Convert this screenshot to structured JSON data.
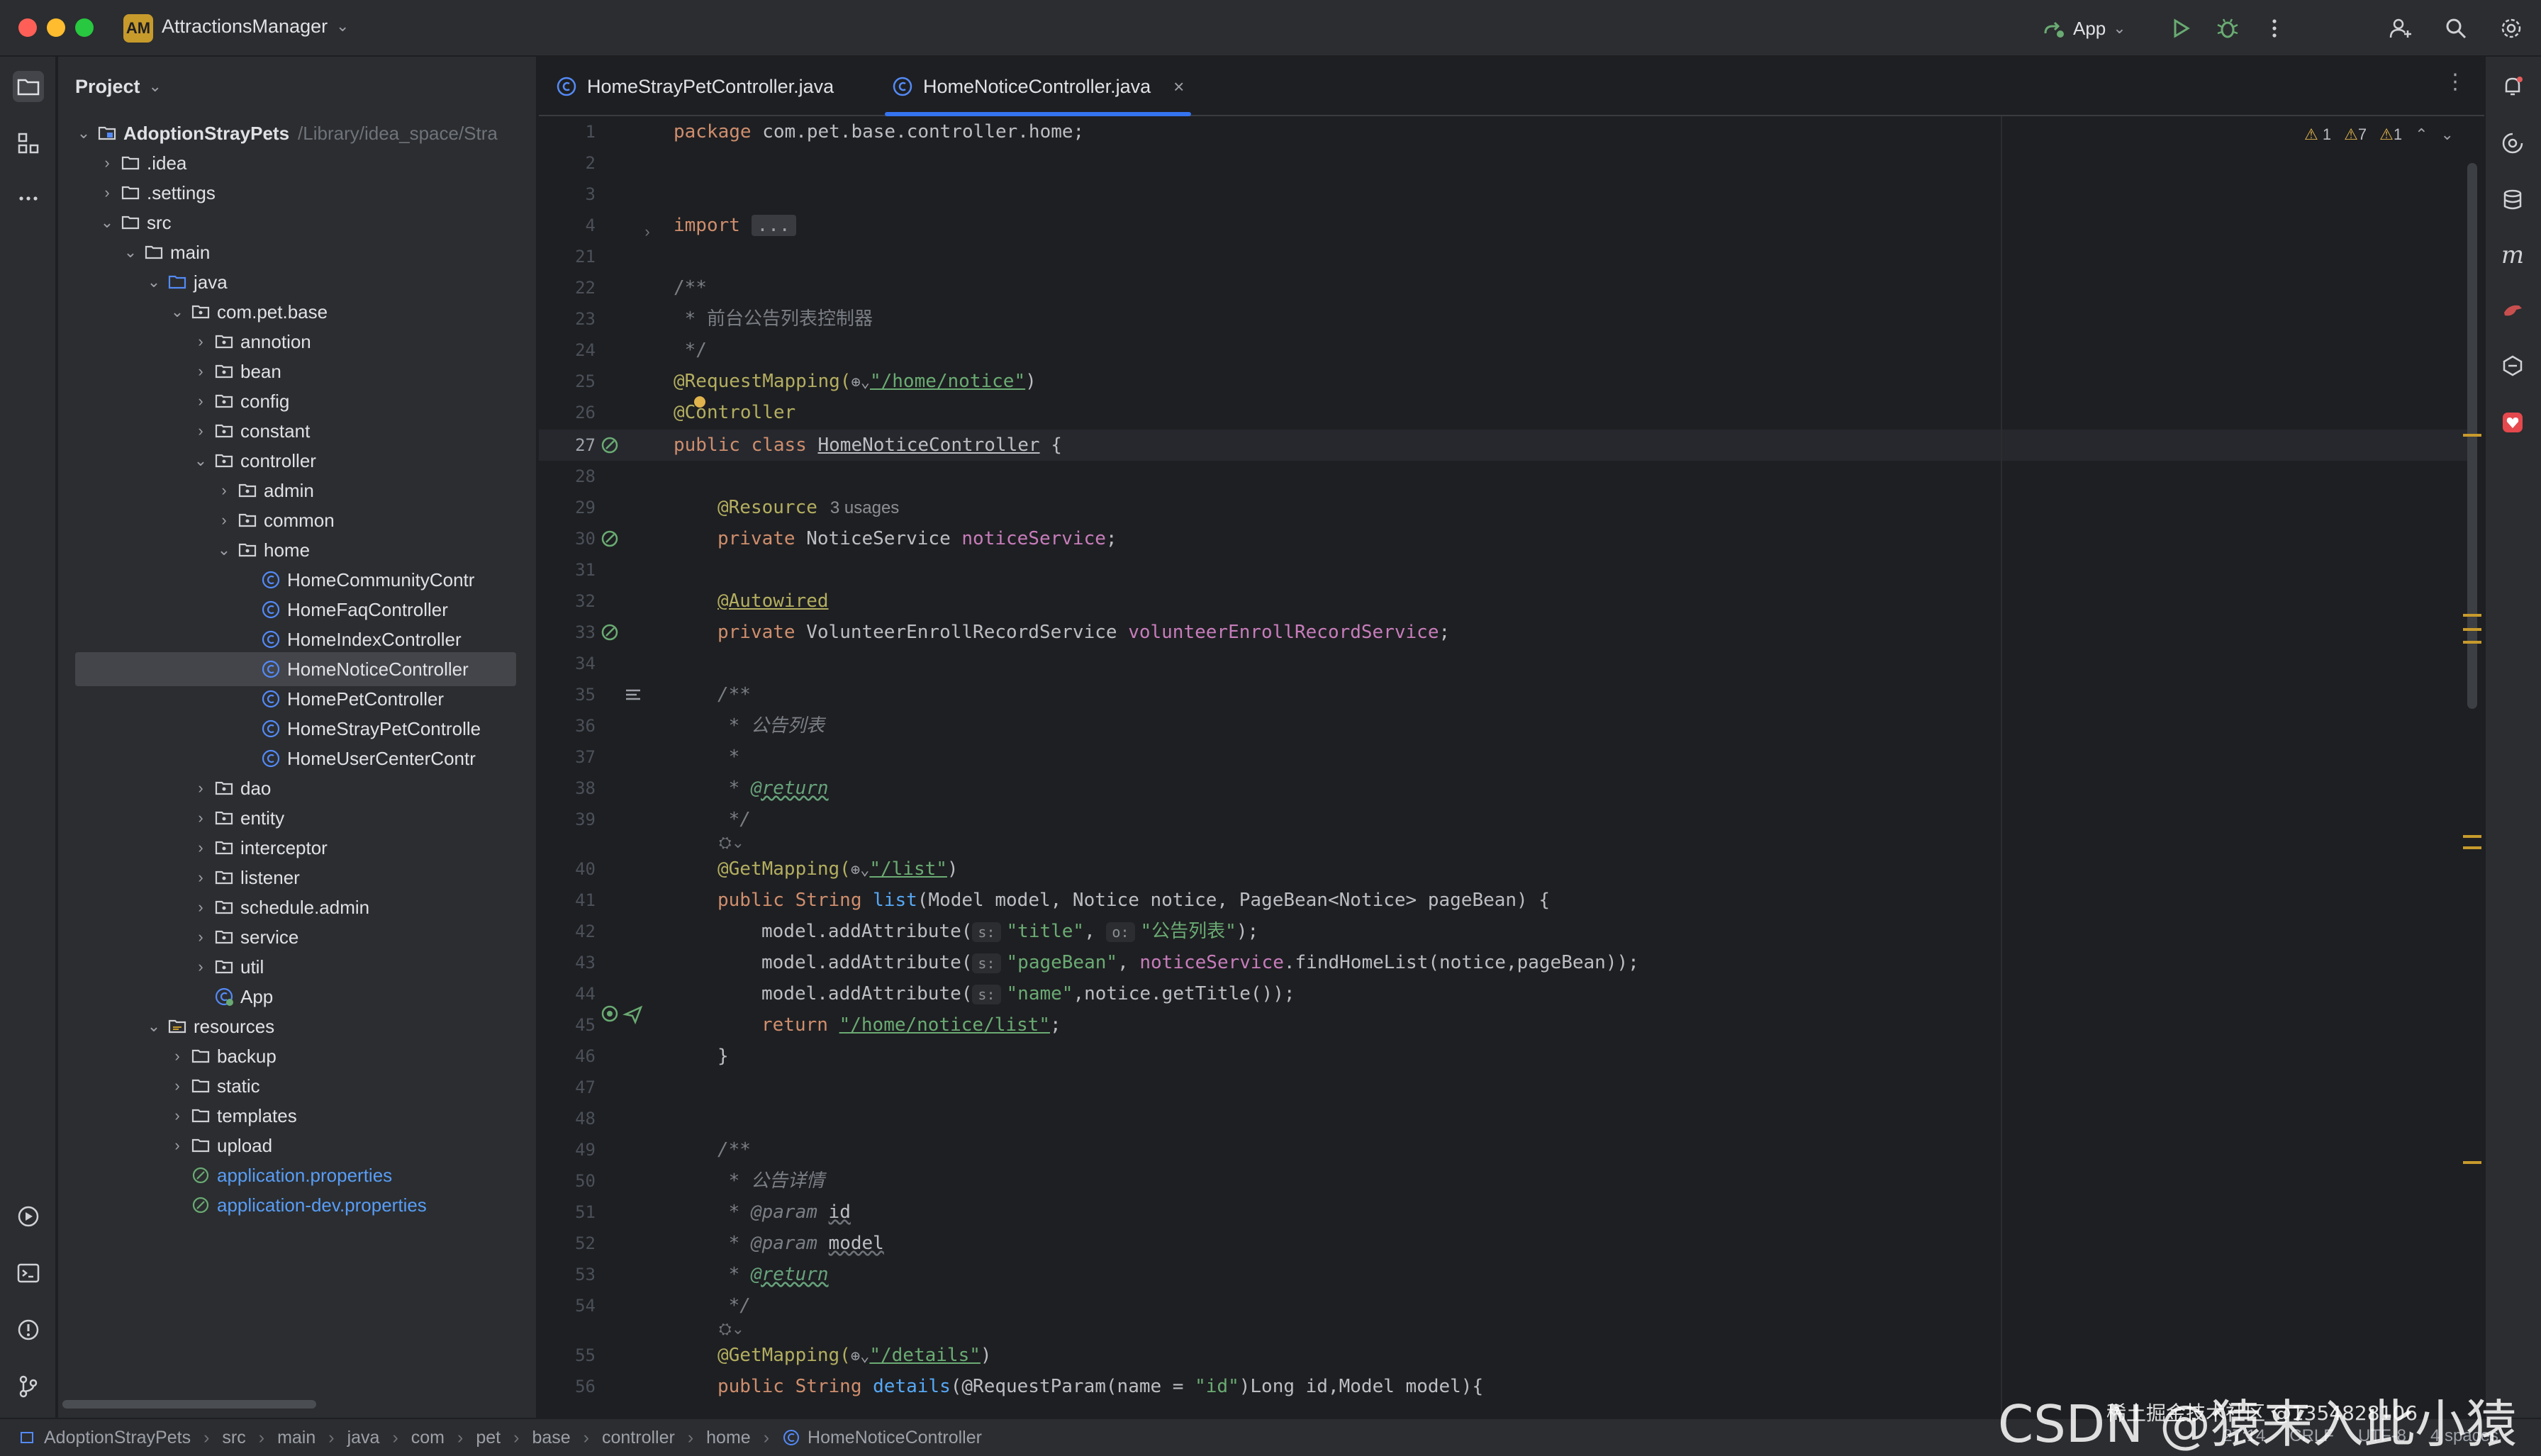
{
  "window": {
    "project_badge": "AM",
    "project_name": "AttractionsManager",
    "run_config": "App"
  },
  "project_panel": {
    "title": "Project",
    "root_name": "AdoptionStrayPets",
    "root_path": "/Library/idea_space/Stra",
    "tree": [
      {
        "label": "AdoptionStrayPets",
        "depth": 0,
        "arrow": "open",
        "icon": "module"
      },
      {
        "label": ".idea",
        "depth": 1,
        "arrow": "closed",
        "icon": "folder"
      },
      {
        "label": ".settings",
        "depth": 1,
        "arrow": "closed",
        "icon": "folder"
      },
      {
        "label": "src",
        "depth": 1,
        "arrow": "open",
        "icon": "folder"
      },
      {
        "label": "main",
        "depth": 2,
        "arrow": "open",
        "icon": "folder"
      },
      {
        "label": "java",
        "depth": 3,
        "arrow": "open",
        "icon": "source-folder"
      },
      {
        "label": "com.pet.base",
        "depth": 4,
        "arrow": "open",
        "icon": "package"
      },
      {
        "label": "annotion",
        "depth": 5,
        "arrow": "closed",
        "icon": "package"
      },
      {
        "label": "bean",
        "depth": 5,
        "arrow": "closed",
        "icon": "package"
      },
      {
        "label": "config",
        "depth": 5,
        "arrow": "closed",
        "icon": "package"
      },
      {
        "label": "constant",
        "depth": 5,
        "arrow": "closed",
        "icon": "package"
      },
      {
        "label": "controller",
        "depth": 5,
        "arrow": "open",
        "icon": "package"
      },
      {
        "label": "admin",
        "depth": 6,
        "arrow": "closed",
        "icon": "package"
      },
      {
        "label": "common",
        "depth": 6,
        "arrow": "closed",
        "icon": "package"
      },
      {
        "label": "home",
        "depth": 6,
        "arrow": "open",
        "icon": "package"
      },
      {
        "label": "HomeCommunityContr",
        "depth": 7,
        "arrow": "none",
        "icon": "class"
      },
      {
        "label": "HomeFaqController",
        "depth": 7,
        "arrow": "none",
        "icon": "class"
      },
      {
        "label": "HomeIndexController",
        "depth": 7,
        "arrow": "none",
        "icon": "class"
      },
      {
        "label": "HomeNoticeController",
        "depth": 7,
        "arrow": "none",
        "icon": "class",
        "selected": true
      },
      {
        "label": "HomePetController",
        "depth": 7,
        "arrow": "none",
        "icon": "class"
      },
      {
        "label": "HomeStrayPetControlle",
        "depth": 7,
        "arrow": "none",
        "icon": "class"
      },
      {
        "label": "HomeUserCenterContr",
        "depth": 7,
        "arrow": "none",
        "icon": "class"
      },
      {
        "label": "dao",
        "depth": 5,
        "arrow": "closed",
        "icon": "package"
      },
      {
        "label": "entity",
        "depth": 5,
        "arrow": "closed",
        "icon": "package"
      },
      {
        "label": "interceptor",
        "depth": 5,
        "arrow": "closed",
        "icon": "package"
      },
      {
        "label": "listener",
        "depth": 5,
        "arrow": "closed",
        "icon": "package"
      },
      {
        "label": "schedule.admin",
        "depth": 5,
        "arrow": "closed",
        "icon": "package"
      },
      {
        "label": "service",
        "depth": 5,
        "arrow": "closed",
        "icon": "package"
      },
      {
        "label": "util",
        "depth": 5,
        "arrow": "closed",
        "icon": "package"
      },
      {
        "label": "App",
        "depth": 5,
        "arrow": "none",
        "icon": "spring-class"
      },
      {
        "label": "resources",
        "depth": 3,
        "arrow": "open",
        "icon": "resources-folder"
      },
      {
        "label": "backup",
        "depth": 4,
        "arrow": "closed",
        "icon": "folder"
      },
      {
        "label": "static",
        "depth": 4,
        "arrow": "closed",
        "icon": "folder"
      },
      {
        "label": "templates",
        "depth": 4,
        "arrow": "closed",
        "icon": "folder"
      },
      {
        "label": "upload",
        "depth": 4,
        "arrow": "closed",
        "icon": "folder"
      },
      {
        "label": "application.properties",
        "depth": 4,
        "arrow": "none",
        "icon": "properties"
      },
      {
        "label": "application-dev.properties",
        "depth": 4,
        "arrow": "none",
        "icon": "properties"
      }
    ]
  },
  "tabs": [
    {
      "label": "HomeStrayPetController.java",
      "active": false
    },
    {
      "label": "HomeNoticeController.java",
      "active": true
    }
  ],
  "inspections": {
    "warn_a": "1",
    "warn_b": "7",
    "warn_c": "1"
  },
  "editor": {
    "current_line": "27",
    "line_numbers": [
      "1",
      "2",
      "3",
      "4",
      "21",
      "22",
      "23",
      "24",
      "25",
      "26",
      "27",
      "28",
      "29",
      "30",
      "31",
      "32",
      "33",
      "34",
      "35",
      "36",
      "37",
      "38",
      "39",
      "",
      "40",
      "41",
      "42",
      "43",
      "44",
      "45",
      "46",
      "47",
      "48",
      "49",
      "50",
      "51",
      "52",
      "53",
      "54",
      "",
      "55",
      "56"
    ],
    "t": {
      "package_kw": "package",
      "package_name": " com.pet.base.controller.home;",
      "import_kw": "import",
      "import_fold": "...",
      "c1": "/**",
      "c2": " * 前台公告列表控制器",
      "c3": " */",
      "rm": "@RequestMapping(",
      "rm_path": "\"/home/notice\"",
      "close_paren": ")",
      "ctrl": "@Controller",
      "pub_class": "public class ",
      "class_name": "HomeNoticeController",
      "brace": " {",
      "resource": "@Resource",
      "usages": "3 usages",
      "private": "private ",
      "notice_type": "NoticeService ",
      "notice_field": "noticeService",
      "semi": ";",
      "autowired": "@Autowired",
      "vol_type": "VolunteerEnrollRecordService ",
      "vol_field": "volunteerEnrollRecordService",
      "d1": "/**",
      "d2": " * 公告列表",
      "d3": " *",
      "d4a": " * ",
      "return_tag": "@return",
      "d5": " */",
      "gm": "@GetMapping(",
      "gm_list": "\"/list\"",
      "pub_string": "public String ",
      "list_fn": "list",
      "list_params": "(Model model, Notice notice, PageBean<Notice> pageBean) {",
      "ma1": "model.addAttribute(",
      "s_hint": "s:",
      "o_hint": "o:",
      "title_str": "\"title\"",
      "title_val": "\"公告列表\"",
      "close_semi": ");",
      "pagebean_str": "\"pageBean\"",
      "find_call": ".findHomeList(notice,pageBean));",
      "name_str": "\"name\"",
      "get_title": ",notice.getTitle());",
      "return_kw": "return ",
      "return_path": "\"/home/notice/list\"",
      "close_brace": "}",
      "e1": "/**",
      "e2": " * 公告详情",
      "param_tag": "@param",
      "id_param": "id",
      "model_param": "model",
      "gm_details": "\"/details\"",
      "details_fn": "details",
      "req_param": "(@RequestParam(name = ",
      "id_str": "\"id\"",
      "details_rest": ")Long id,Model model){",
      "comma": ", ",
      "space": " "
    }
  },
  "statusbar": {
    "breadcrumbs": [
      "AdoptionStrayPets",
      "src",
      "main",
      "java",
      "com",
      "pet",
      "base",
      "controller",
      "home",
      "HomeNoticeController"
    ],
    "position": "27:14",
    "line_sep": "CRLF",
    "encoding": "UTF-8",
    "indent": "4 spaces"
  },
  "watermark": {
    "main": "CSDN @猿来入此小猿",
    "small": "稀土掘金技术社区 @1354828106"
  }
}
